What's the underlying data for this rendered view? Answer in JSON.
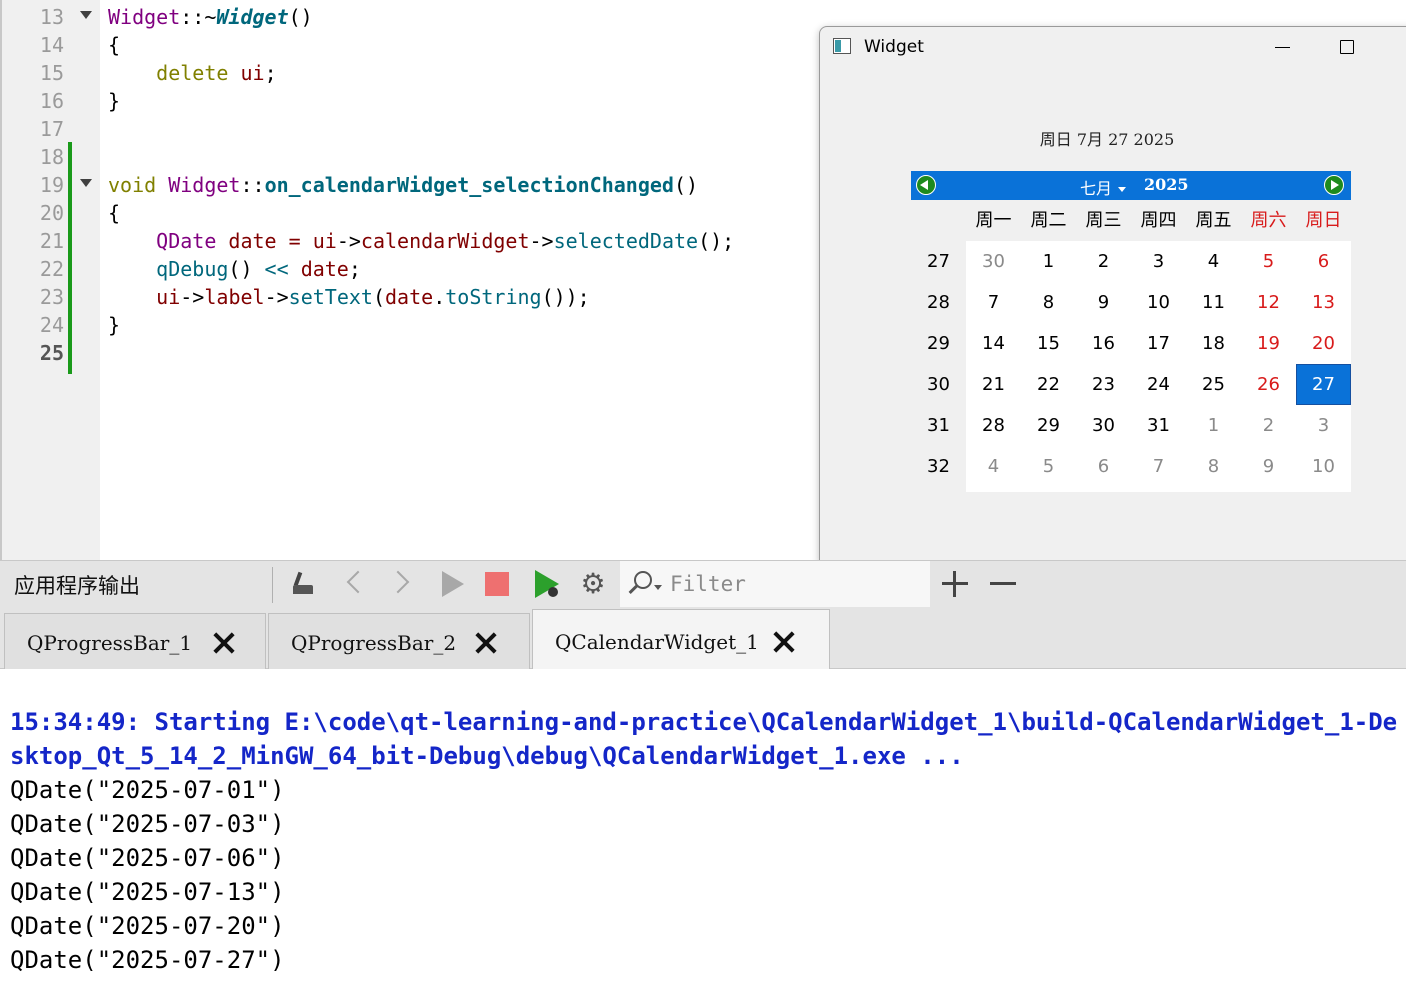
{
  "editor": {
    "line_numbers": [
      "13",
      "14",
      "15",
      "16",
      "17",
      "18",
      "19",
      "20",
      "21",
      "22",
      "23",
      "24",
      "25"
    ],
    "code": {
      "l13": {
        "cls": "Widget",
        "sep": "::~",
        "fn": "Widget",
        "tail": "()"
      },
      "l14": "{",
      "l15": {
        "indent": "    ",
        "kw": "delete",
        "space": " ",
        "mem": "ui",
        "tail": ";"
      },
      "l16": "}",
      "l19": {
        "kw": "void",
        "space": " ",
        "cls": "Widget",
        "sep": "::",
        "fn": "on_calendarWidget_selectionChanged",
        "tail": "()"
      },
      "l20": "{",
      "l21": {
        "indent": "    ",
        "cls": "QDate",
        "mid": " date = ",
        "mem1": "ui",
        "arrow1": "->",
        "mem2": "calendarWidget",
        "arrow2": "->",
        "fn": "selectedDate",
        "tail": "();"
      },
      "l22": {
        "indent": "    ",
        "fn": "qDebug",
        "paren": "()",
        "op": " << ",
        "var": "date",
        "tail": ";"
      },
      "l23": {
        "indent": "    ",
        "mem1": "ui",
        "arrow1": "->",
        "mem2": "label",
        "arrow2": "->",
        "fn": "setText",
        "open": "(",
        "var": "date",
        "dot": ".",
        "fn2": "toString",
        "tail": "());"
      },
      "l24": "}"
    }
  },
  "window": {
    "title": "Widget",
    "date_label": "周日 7月 27 2025",
    "calendar": {
      "month": "七月",
      "year": "2025",
      "weekday_headers": [
        "周一",
        "周二",
        "周三",
        "周四",
        "周五",
        "周六",
        "周日"
      ],
      "week_numbers": [
        "27",
        "28",
        "29",
        "30",
        "31",
        "32"
      ],
      "rows": [
        [
          "30",
          "1",
          "2",
          "3",
          "4",
          "5",
          "6"
        ],
        [
          "7",
          "8",
          "9",
          "10",
          "11",
          "12",
          "13"
        ],
        [
          "14",
          "15",
          "16",
          "17",
          "18",
          "19",
          "20"
        ],
        [
          "21",
          "22",
          "23",
          "24",
          "25",
          "26",
          "27"
        ],
        [
          "28",
          "29",
          "30",
          "31",
          "1",
          "2",
          "3"
        ],
        [
          "4",
          "5",
          "6",
          "7",
          "8",
          "9",
          "10"
        ]
      ],
      "selected_day": "27",
      "colors": {
        "header": "#0a72d8",
        "weekend": "#d81b1b",
        "other_month": "#8a8a8a",
        "nav_button": "#1e8a1e"
      }
    }
  },
  "output_pane": {
    "title": "应用程序输出",
    "filter_placeholder": "Filter",
    "tabs": [
      {
        "label": "QProgressBar_1",
        "active": false
      },
      {
        "label": "QProgressBar_2",
        "active": false
      },
      {
        "label": "QCalendarWidget_1",
        "active": true
      }
    ],
    "toolbar_icons": [
      "clean-icon",
      "previous-icon",
      "next-icon",
      "run-icon",
      "stop-icon",
      "debug-run-icon",
      "settings-icon",
      "filter-search-icon",
      "zoom-in-icon",
      "zoom-out-icon"
    ],
    "lines": [
      {
        "kind": "info",
        "text": "15:34:49: Starting E:\\code\\qt-learning-and-practice\\QCalendarWidget_1\\build-QCalendarWidget_1-Desktop_Qt_5_14_2_MinGW_64_bit-Debug\\debug\\QCalendarWidget_1.exe ..."
      },
      {
        "kind": "log",
        "text": "QDate(\"2025-07-01\")"
      },
      {
        "kind": "log",
        "text": "QDate(\"2025-07-03\")"
      },
      {
        "kind": "log",
        "text": "QDate(\"2025-07-06\")"
      },
      {
        "kind": "log",
        "text": "QDate(\"2025-07-13\")"
      },
      {
        "kind": "log",
        "text": "QDate(\"2025-07-20\")"
      },
      {
        "kind": "log",
        "text": "QDate(\"2025-07-27\")"
      }
    ],
    "output_colors": {
      "info": "#1426c8",
      "log": "#000000"
    }
  }
}
